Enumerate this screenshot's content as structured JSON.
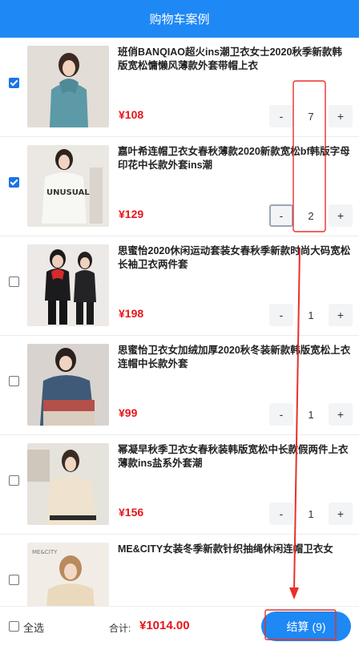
{
  "header": {
    "title": "购物车案例"
  },
  "items": [
    {
      "title": "班俏BANQIAO超火ins潮卫衣女士2020秋季新款韩版宽松慵懒风薄款外套带帽上衣",
      "price": "¥108",
      "qty": "7",
      "checked": true
    },
    {
      "title": "嘉叶希连帽卫衣女春秋薄款2020新款宽松bf韩版字母印花中长款外套ins潮",
      "price": "¥129",
      "qty": "2",
      "checked": true
    },
    {
      "title": "思蜜怡2020休闲运动套装女春秋季新款时尚大码宽松长袖卫衣两件套",
      "price": "¥198",
      "qty": "1",
      "checked": false
    },
    {
      "title": "思蜜怡卫衣女加绒加厚2020秋冬装新款韩版宽松上衣连帽中长款外套",
      "price": "¥99",
      "qty": "1",
      "checked": false
    },
    {
      "title": "幂凝早秋季卫衣女春秋装韩版宽松中长款假两件上衣薄款ins盐系外套潮",
      "price": "¥156",
      "qty": "1",
      "checked": false
    },
    {
      "title": "ME&CITY女装冬季新款针织抽绳休闲连帽卫衣女",
      "price": "",
      "qty": "",
      "checked": false
    }
  ],
  "qty_minus": "-",
  "qty_plus": "+",
  "footer": {
    "select_all": "全选",
    "total_label": "合计:",
    "total_value": "¥1014.00",
    "checkout_label": "结算",
    "checkout_count": "(9)"
  },
  "colors": {
    "accent": "#1e88f5",
    "price": "#e5161c",
    "annotation": "#e8302a"
  }
}
